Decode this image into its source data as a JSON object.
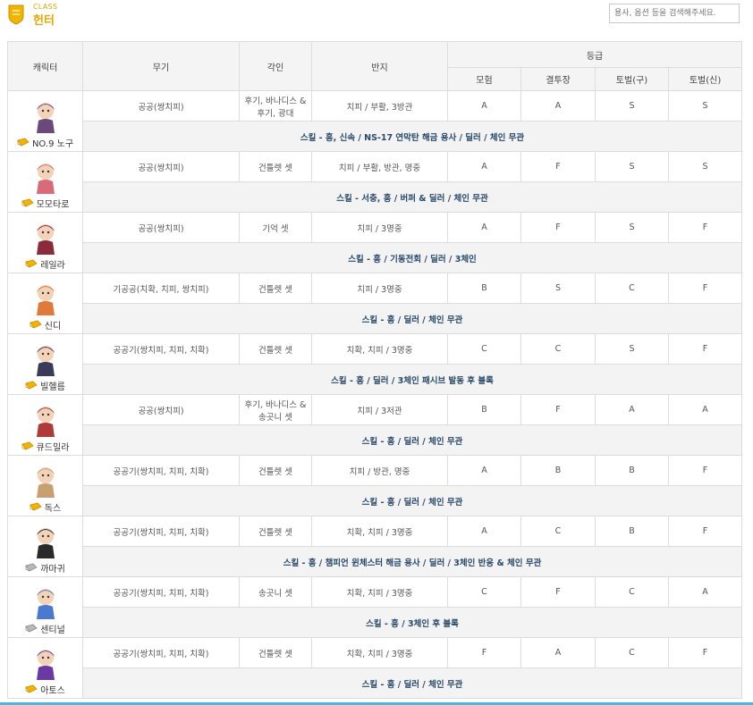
{
  "header": {
    "class_small": "CLASS",
    "class_title": "헌터",
    "search_placeholder": "용사, 옵션 등을 검색해주세요."
  },
  "table": {
    "headers": {
      "character": "캐릭터",
      "weapon": "무기",
      "inscription": "각인",
      "ring": "반지",
      "grade": "등급",
      "grades": [
        "모험",
        "결투장",
        "토벌(구)",
        "토벌(신)"
      ]
    },
    "rows": [
      {
        "name": "NO.9 노구",
        "badge": "gold",
        "weapon": "공공(쌍치피)",
        "inscription": "후기, 바나디스 & 후기, 광대",
        "ring": "치피 / 부활, 3방관",
        "grades": [
          "A",
          "A",
          "S",
          "S"
        ],
        "skill": "스킬 - 흥, 신속 / NS-17 연막탄 해금 용사 / 딜러 / 체인 무관",
        "avatar": "#6a4a7a"
      },
      {
        "name": "모모타로",
        "badge": "gold",
        "weapon": "공공(쌍치피)",
        "inscription": "건틀렛 셋",
        "ring": "치피 / 부활, 방관, 명중",
        "grades": [
          "A",
          "F",
          "S",
          "S"
        ],
        "skill": "스킬 - 서충, 흥 / 버퍼 & 딜러 / 체인 무관",
        "avatar": "#d86a7a"
      },
      {
        "name": "레일라",
        "badge": "gold",
        "weapon": "공공(쌍치피)",
        "inscription": "기억 셋",
        "ring": "치피 / 3명중",
        "grades": [
          "A",
          "F",
          "S",
          "F"
        ],
        "skill": "스킬 - 흥 / 기동전회 / 딜러 / 3체인",
        "avatar": "#8a2a3a"
      },
      {
        "name": "신디",
        "badge": "gold",
        "weapon": "기공공(치확, 치피, 쌍치피)",
        "inscription": "건틀렛 셋",
        "ring": "치피 / 3명중",
        "grades": [
          "B",
          "S",
          "C",
          "F"
        ],
        "skill": "스킬 - 흥 / 딜러 / 체인 무관",
        "avatar": "#e07a3a"
      },
      {
        "name": "빌헬름",
        "badge": "gold",
        "weapon": "공공기(쌍치피, 치피, 치확)",
        "inscription": "건틀렛 셋",
        "ring": "치확, 치피 / 3명중",
        "grades": [
          "C",
          "C",
          "S",
          "F"
        ],
        "skill": "스킬 - 흥 / 딜러 / 3체인 패시브 발동 후 블록",
        "avatar": "#3a3a5a"
      },
      {
        "name": "큐드밀라",
        "badge": "gold",
        "weapon": "공공(쌍치피)",
        "inscription": "후기, 바나디스 & 송곳니 셋",
        "ring": "치피 / 3저관",
        "grades": [
          "B",
          "F",
          "A",
          "A"
        ],
        "skill": "스킬 - 흥 / 딜러 / 체인 무관",
        "avatar": "#b03a3a"
      },
      {
        "name": "독스",
        "badge": "gold",
        "weapon": "공공기(쌍치피, 치피, 치확)",
        "inscription": "건틀렛 셋",
        "ring": "치피 / 방관, 명중",
        "grades": [
          "A",
          "B",
          "B",
          "F"
        ],
        "skill": "스킬 - 흥 / 딜러 / 체인 무관",
        "avatar": "#c8a070"
      },
      {
        "name": "까마귀",
        "badge": "silver",
        "weapon": "공공기(쌍치피, 치피, 치확)",
        "inscription": "건틀렛 셋",
        "ring": "치확, 치피 / 3명중",
        "grades": [
          "A",
          "C",
          "B",
          "F"
        ],
        "skill": "스킬 - 흥 / 챔피언 윈체스터 해금 용사 / 딜러 / 3체인 반응 & 체인 무관",
        "avatar": "#2a2a2a"
      },
      {
        "name": "센티널",
        "badge": "silver",
        "weapon": "공공기(쌍치피, 치피, 치확)",
        "inscription": "송곳니 셋",
        "ring": "치확, 치피 / 3명중",
        "grades": [
          "C",
          "F",
          "C",
          "A"
        ],
        "skill": "스킬 - 흥 / 3체인 후 블록",
        "avatar": "#4a7ad0"
      },
      {
        "name": "아토스",
        "badge": "gold",
        "weapon": "공공기(쌍치피, 치피, 치확)",
        "inscription": "건틀렛 셋",
        "ring": "치확, 치피 / 3명중",
        "grades": [
          "F",
          "A",
          "C",
          "F"
        ],
        "skill": "스킬 - 흥 / 딜러 / 체인 무관",
        "avatar": "#6a3aa0"
      }
    ]
  },
  "colors": {
    "grade_A": "#e0209a",
    "grade_S": "#e89a20",
    "title": "#e6a700",
    "accent_line": "#4fb5d9"
  }
}
